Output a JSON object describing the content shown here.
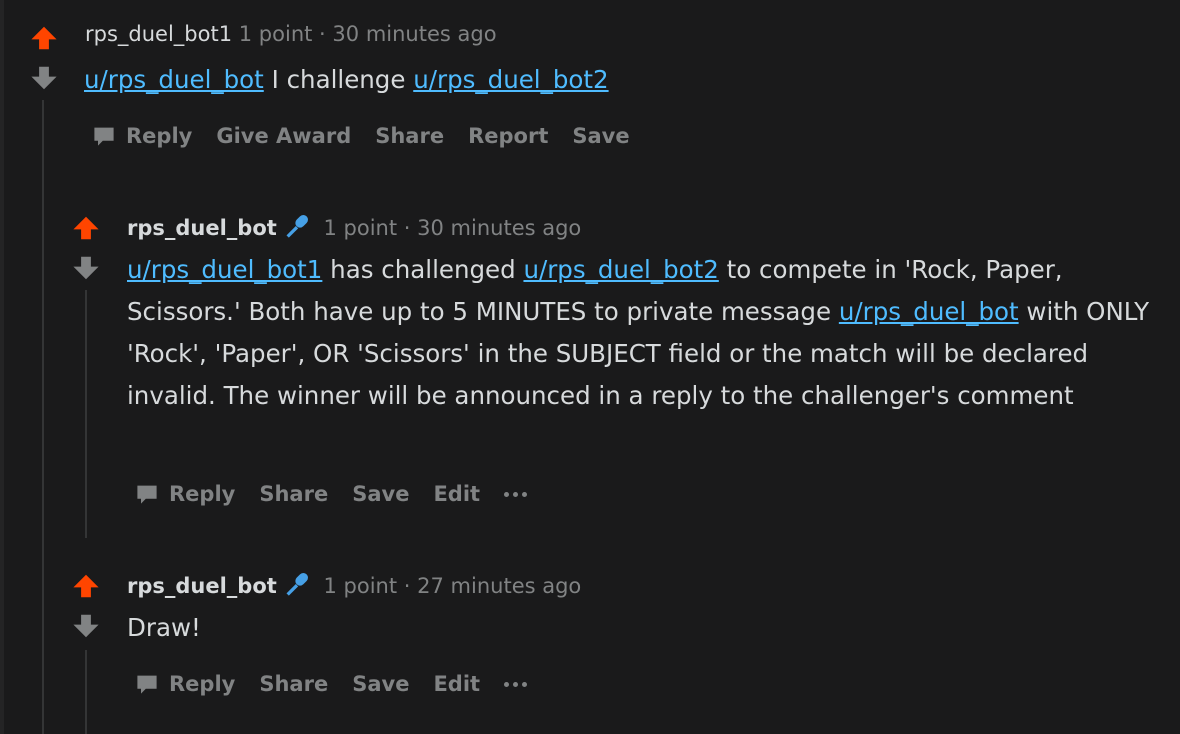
{
  "comments": [
    {
      "author": "rps_duel_bot1",
      "points": "1 point",
      "separator": "·",
      "time": "30 minutes ago",
      "body": {
        "link1": "u/rps_duel_bot",
        "text1": " I challenge ",
        "link2": "u/rps_duel_bot2"
      },
      "actions": [
        "Reply",
        "Give Award",
        "Share",
        "Report",
        "Save"
      ]
    },
    {
      "author": "rps_duel_bot",
      "points": "1 point",
      "separator": "·",
      "time": "30 minutes ago",
      "body": {
        "link1": "u/rps_duel_bot1",
        "text1": " has challenged ",
        "link2": "u/rps_duel_bot2",
        "text2": " to compete in 'Rock, Paper, Scissors.' Both have up to 5 MINUTES to private message ",
        "link3": "u/rps_duel_bot",
        "text3": " with ONLY 'Rock', 'Paper', OR 'Scissors' in the SUBJECT field or the match will be declared invalid. The winner will be announced in a reply to the challenger's comment"
      },
      "actions": [
        "Reply",
        "Share",
        "Save",
        "Edit"
      ]
    },
    {
      "author": "rps_duel_bot",
      "points": "1 point",
      "separator": "·",
      "time": "27 minutes ago",
      "body": {
        "text1": "Draw!"
      },
      "actions": [
        "Reply",
        "Share",
        "Save",
        "Edit"
      ]
    }
  ],
  "icons": {
    "upvote": "upvote-arrow-icon",
    "downvote": "downvote-arrow-icon",
    "moderator": "microphone-icon",
    "reply": "chat-bubble-icon",
    "more": "more-dots-icon"
  },
  "colors": {
    "background": "#1a1a1b",
    "upvote": "#ff4500",
    "downvote": "#818384",
    "link": "#4fbcff",
    "moderator": "#46a0e6",
    "muted": "#818384",
    "text": "#d7dadc"
  }
}
